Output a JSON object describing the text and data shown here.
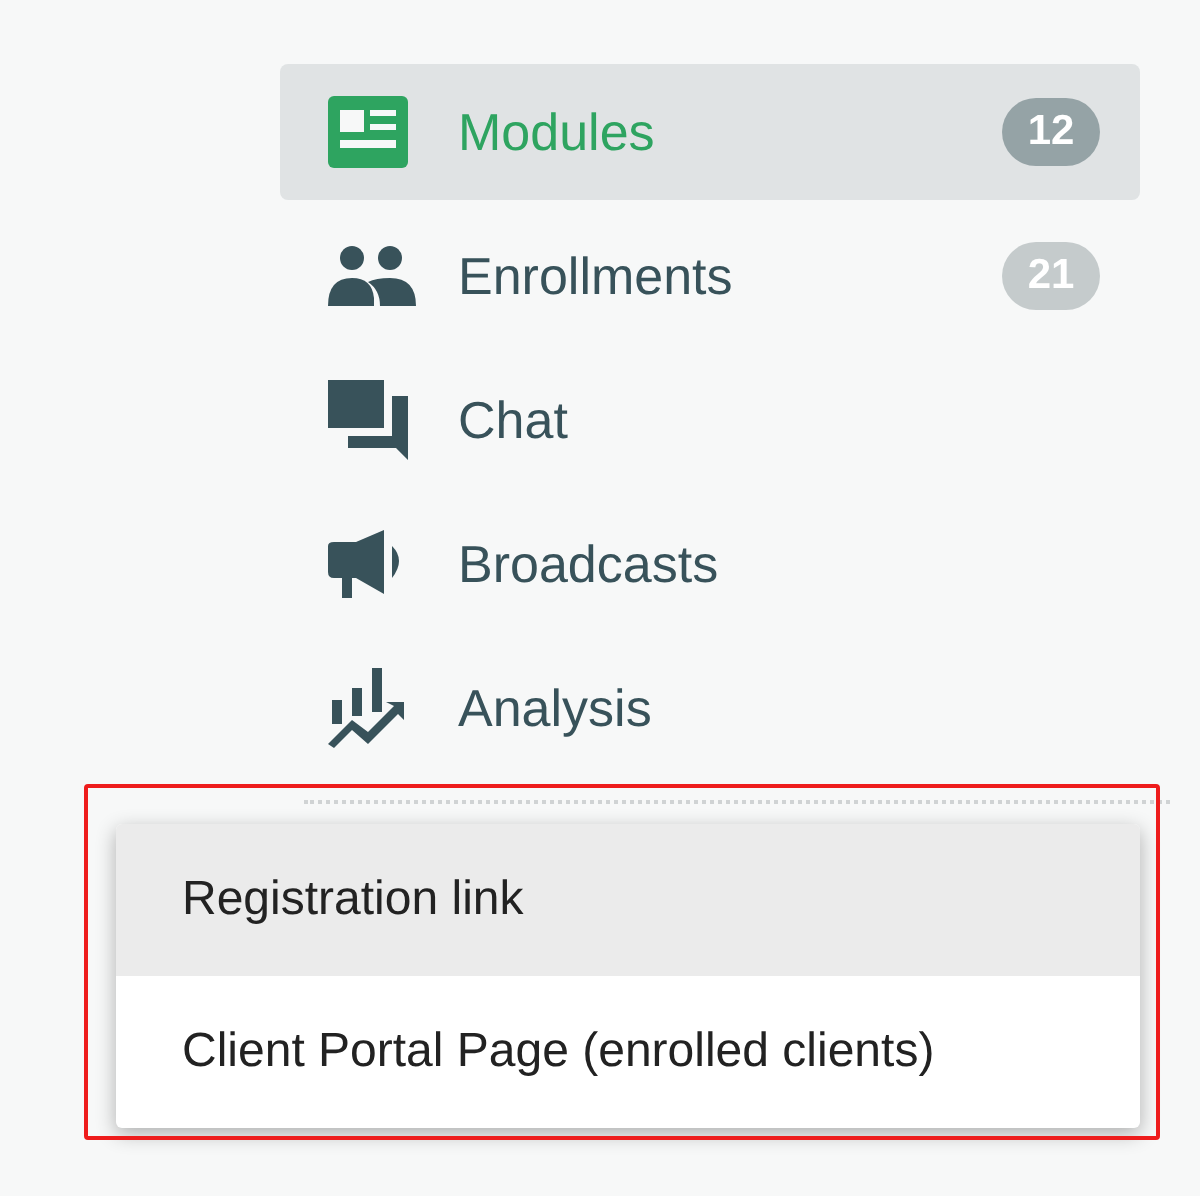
{
  "sidebar": {
    "items": [
      {
        "kind": "modules",
        "label": "Modules",
        "badge": "12",
        "selected": true
      },
      {
        "kind": "people",
        "label": "Enrollments",
        "badge": "21",
        "selected": false
      },
      {
        "kind": "chat",
        "label": "Chat",
        "selected": false
      },
      {
        "kind": "megaphone",
        "label": "Broadcasts",
        "selected": false
      },
      {
        "kind": "analysis",
        "label": "Analysis",
        "selected": false
      }
    ]
  },
  "menu": {
    "highlighted": true,
    "items": [
      {
        "label": "Registration link",
        "selected": true
      },
      {
        "label": "Client Portal Page (enrolled clients)",
        "selected": false
      }
    ]
  }
}
